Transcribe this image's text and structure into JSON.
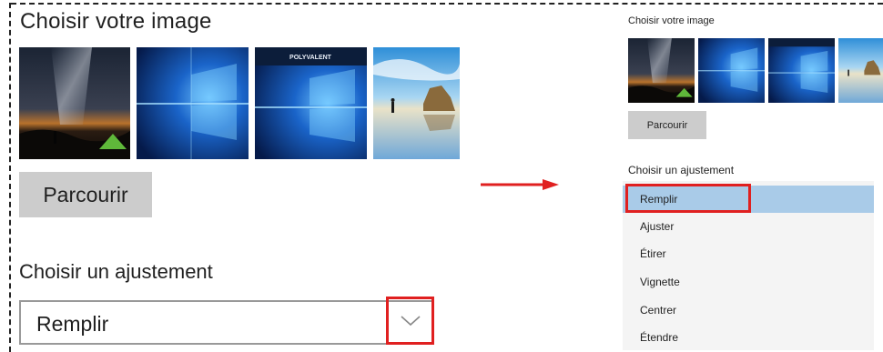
{
  "left_panel": {
    "title": "Choisir votre image",
    "thumbnails": [
      {
        "name": "milky-way-night"
      },
      {
        "name": "windows-blue"
      },
      {
        "name": "windows-blue-banner",
        "banner_text": "POLYVALENT"
      },
      {
        "name": "beach-rocks"
      }
    ],
    "browse_label": "Parcourir",
    "fit_title": "Choisir un ajustement",
    "fit_value": "Remplir",
    "highlight_color": "#e02020"
  },
  "right_panel": {
    "title": "Choisir votre image",
    "browse_label": "Parcourir",
    "fit_title": "Choisir un ajustement",
    "fit_options": [
      "Remplir",
      "Ajuster",
      "Étirer",
      "Vignette",
      "Centrer",
      "Étendre"
    ],
    "selected_option": "Remplir",
    "selected_bg": "#a9cbe8"
  },
  "arrow_color": "#e02020"
}
